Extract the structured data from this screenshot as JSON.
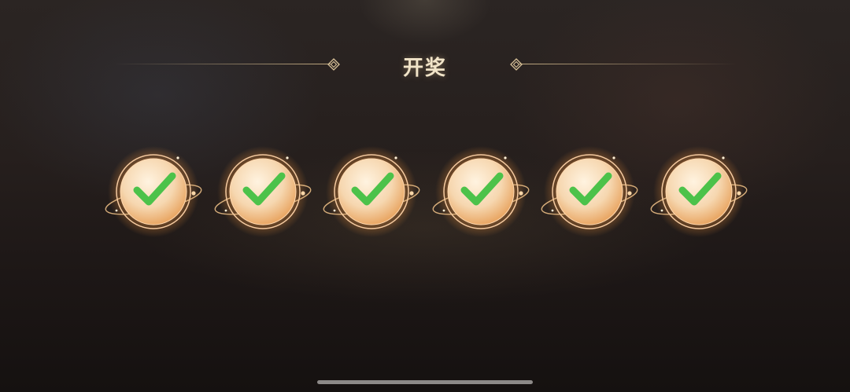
{
  "header": {
    "title": "开奖"
  },
  "draw_results": {
    "count": 6,
    "items": [
      {
        "state": "checked",
        "icon": "check-icon"
      },
      {
        "state": "checked",
        "icon": "check-icon"
      },
      {
        "state": "checked",
        "icon": "check-icon"
      },
      {
        "state": "checked",
        "icon": "check-icon"
      },
      {
        "state": "checked",
        "icon": "check-icon"
      },
      {
        "state": "checked",
        "icon": "check-icon"
      }
    ]
  },
  "colors": {
    "title": "#f1e4c8",
    "orb_fill": "#f6d7b0",
    "orb_glow": "#ff9a3c",
    "check": "#4cc24a",
    "line": "#d2b98c"
  }
}
